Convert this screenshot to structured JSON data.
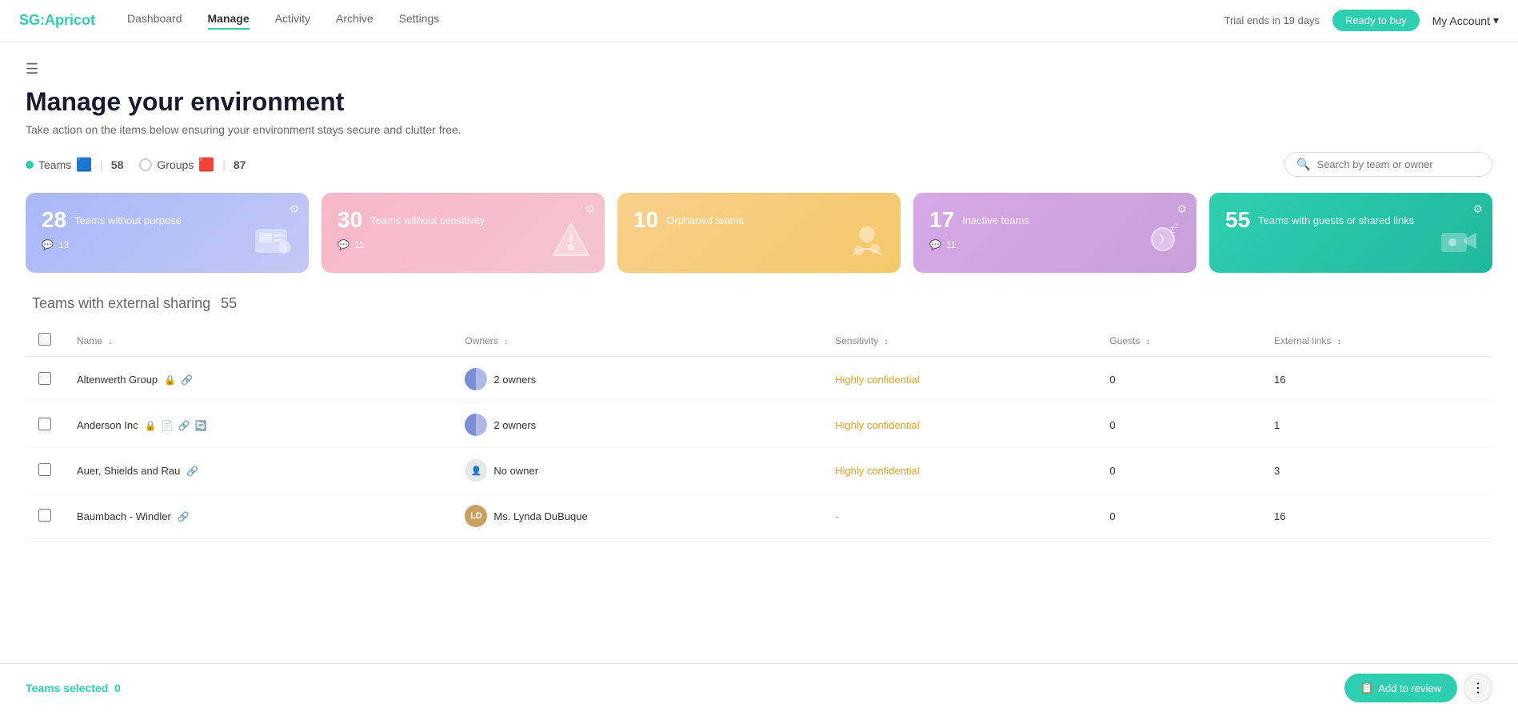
{
  "app": {
    "logo_sg": "SG:",
    "logo_apricot": "Apricot"
  },
  "nav": {
    "links": [
      {
        "label": "Dashboard",
        "active": false
      },
      {
        "label": "Manage",
        "active": true
      },
      {
        "label": "Activity",
        "active": false
      },
      {
        "label": "Archive",
        "active": false
      },
      {
        "label": "Settings",
        "active": false
      }
    ],
    "trial_text": "Trial ends in 19 days",
    "ready_btn": "Ready to buy",
    "account_btn": "My Account"
  },
  "page": {
    "title": "Manage your environment",
    "subtitle": "Take action on the items below ensuring your environment stays secure and clutter free."
  },
  "tabs": {
    "teams_label": "Teams",
    "teams_count": "58",
    "groups_label": "Groups",
    "groups_count": "87",
    "search_placeholder": "Search by team or owner"
  },
  "cards": [
    {
      "number": "28",
      "label": "Teams without purpose",
      "meta_count": "13",
      "color": "blue"
    },
    {
      "number": "30",
      "label": "Teams without sensitivity",
      "meta_count": "11",
      "color": "pink"
    },
    {
      "number": "10",
      "label": "Orphaned teams",
      "meta_count": "",
      "color": "orange"
    },
    {
      "number": "17",
      "label": "Inactive teams",
      "meta_count": "11",
      "color": "purple"
    },
    {
      "number": "55",
      "label": "Teams with guests or shared links",
      "meta_count": "",
      "color": "teal"
    }
  ],
  "table": {
    "section_title": "Teams with external sharing",
    "section_count": "55",
    "columns": [
      {
        "label": "Name",
        "sortable": true
      },
      {
        "label": "Owners",
        "sortable": true
      },
      {
        "label": "Sensitivity",
        "sortable": true
      },
      {
        "label": "Guests",
        "sortable": true
      },
      {
        "label": "External links",
        "sortable": true
      }
    ],
    "rows": [
      {
        "name": "Altenwerth Group",
        "icons": [
          "lock",
          "link"
        ],
        "owners": "2 owners",
        "owner_type": "dual",
        "sensitivity": "Highly confidential",
        "sensitivity_type": "high",
        "guests": "0",
        "external_links": "16"
      },
      {
        "name": "Anderson Inc",
        "icons": [
          "lock",
          "doc",
          "link",
          "refresh"
        ],
        "owners": "2 owners",
        "owner_type": "dual",
        "sensitivity": "Highly confidential",
        "sensitivity_type": "high",
        "guests": "0",
        "external_links": "1"
      },
      {
        "name": "Auer, Shields and Rau",
        "icons": [
          "link"
        ],
        "owners": "No owner",
        "owner_type": "none",
        "sensitivity": "Highly confidential",
        "sensitivity_type": "high",
        "guests": "0",
        "external_links": "3"
      },
      {
        "name": "Baumbach - Windler",
        "icons": [
          "link"
        ],
        "owners": "Ms. Lynda DuBuque",
        "owner_type": "person",
        "owner_initials": "LD",
        "sensitivity": "-",
        "sensitivity_type": "none",
        "guests": "0",
        "external_links": "16"
      }
    ]
  },
  "bottom_bar": {
    "selected_label": "Teams selected",
    "selected_count": "0",
    "add_review_label": "Add to review",
    "more_icon": "⋮"
  }
}
